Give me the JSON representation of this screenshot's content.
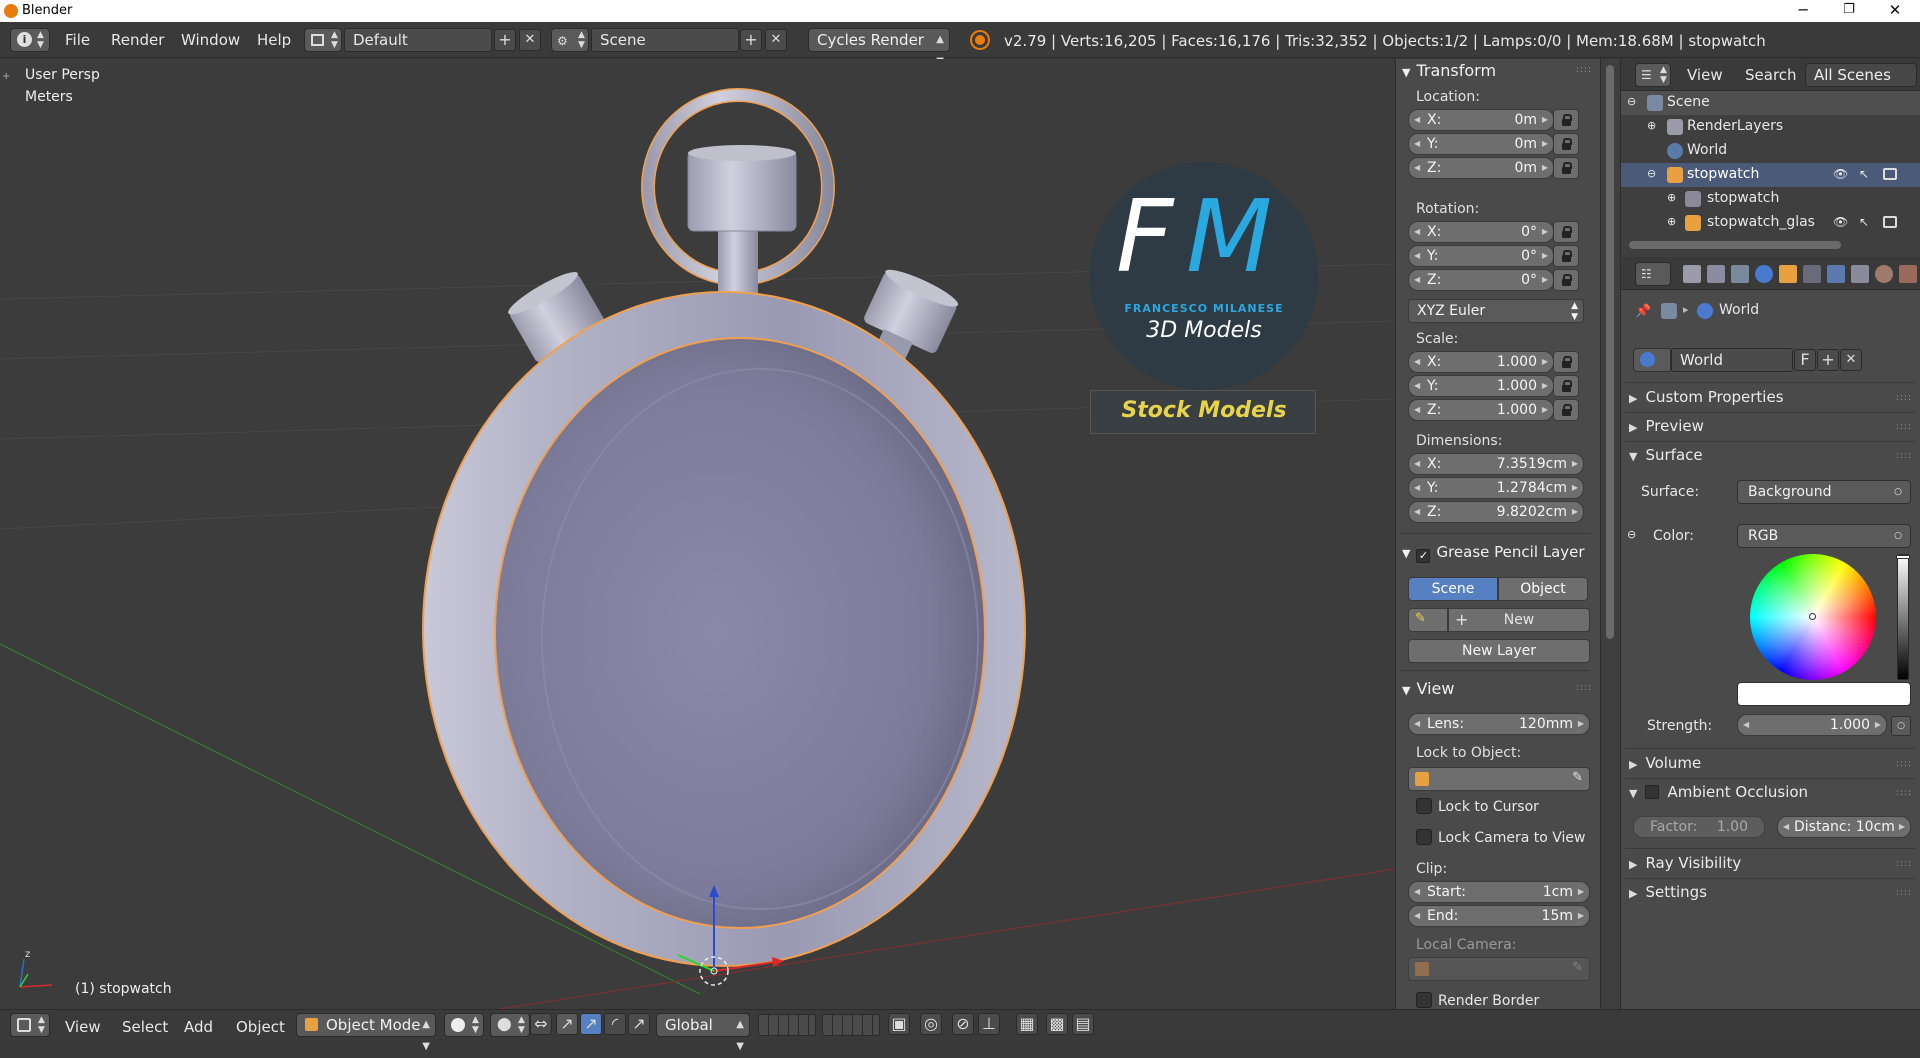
{
  "window": {
    "title": "Blender",
    "minimize": "─",
    "maximize": "❐",
    "close": "✕"
  },
  "topbar": {
    "menus": [
      "File",
      "Render",
      "Window",
      "Help"
    ],
    "layout": "Default",
    "scene": "Scene",
    "engine": "Cycles Render",
    "stats": "v2.79 | Verts:16,205 | Faces:16,176 | Tris:32,352 | Objects:1/2 | Lamps:0/0 | Mem:18.68M | stopwatch"
  },
  "viewport": {
    "view_label": "User Persp",
    "units_label": "Meters",
    "object_label": "(1) stopwatch",
    "watermark": {
      "initials_f": "F",
      "initials_m": "M",
      "name": "FRANCESCO MILANESE",
      "tagline": "3D Models",
      "banner": "Stock Models"
    }
  },
  "npanel": {
    "transform": {
      "header": "Transform",
      "location_label": "Location:",
      "location": [
        {
          "axis": "X:",
          "value": "0m"
        },
        {
          "axis": "Y:",
          "value": "0m"
        },
        {
          "axis": "Z:",
          "value": "0m"
        }
      ],
      "rotation_label": "Rotation:",
      "rotation": [
        {
          "axis": "X:",
          "value": "0°"
        },
        {
          "axis": "Y:",
          "value": "0°"
        },
        {
          "axis": "Z:",
          "value": "0°"
        }
      ],
      "rotation_mode": "XYZ Euler",
      "scale_label": "Scale:",
      "scale": [
        {
          "axis": "X:",
          "value": "1.000"
        },
        {
          "axis": "Y:",
          "value": "1.000"
        },
        {
          "axis": "Z:",
          "value": "1.000"
        }
      ],
      "dimensions_label": "Dimensions:",
      "dimensions": [
        {
          "axis": "X:",
          "value": "7.3519cm"
        },
        {
          "axis": "Y:",
          "value": "1.2784cm"
        },
        {
          "axis": "Z:",
          "value": "9.8202cm"
        }
      ]
    },
    "grease": {
      "header": "Grease Pencil Layer",
      "scene_tab": "Scene",
      "object_tab": "Object",
      "new_label": "New",
      "new_layer_label": "New Layer"
    },
    "view": {
      "header": "View",
      "lens_key": "Lens:",
      "lens_value": "120mm",
      "lock_to_object_label": "Lock to Object:",
      "lock_to_cursor": "Lock to Cursor",
      "lock_camera": "Lock Camera to View",
      "clip_label": "Clip:",
      "clip_start_key": "Start:",
      "clip_start_value": "1cm",
      "clip_end_key": "End:",
      "clip_end_value": "15m",
      "local_camera_label": "Local Camera:",
      "render_border": "Render Border"
    }
  },
  "outliner": {
    "menus": [
      "View",
      "Search"
    ],
    "filter": "All Scenes",
    "rows": [
      {
        "label": "Scene"
      },
      {
        "label": "RenderLayers"
      },
      {
        "label": "World"
      },
      {
        "label": "stopwatch"
      },
      {
        "label": "stopwatch"
      },
      {
        "label": "stopwatch_glas"
      }
    ]
  },
  "properties": {
    "breadcrumb": "World",
    "world_name": "World",
    "fake_user": "F",
    "sections": {
      "custom_properties": "Custom Properties",
      "preview": "Preview",
      "surface": "Surface",
      "volume": "Volume",
      "ambient_occlusion": "Ambient Occlusion",
      "ray_visibility": "Ray Visibility",
      "settings": "Settings"
    },
    "surface_label": "Surface:",
    "surface_value": "Background",
    "color_label": "Color:",
    "color_value": "RGB",
    "strength_label": "Strength:",
    "strength_value": "1.000",
    "factor_label": "Factor:",
    "factor_value": "1.00",
    "distance_label": "Distanc: 10cm"
  },
  "bottombar": {
    "menus": [
      "View",
      "Select",
      "Add",
      "Object"
    ],
    "mode": "Object Mode",
    "orientation": "Global"
  },
  "colors": {
    "accent_blue": "#5680c2",
    "selection_orange": "#f0a050",
    "watermark_yellow": "#e8d44a"
  }
}
